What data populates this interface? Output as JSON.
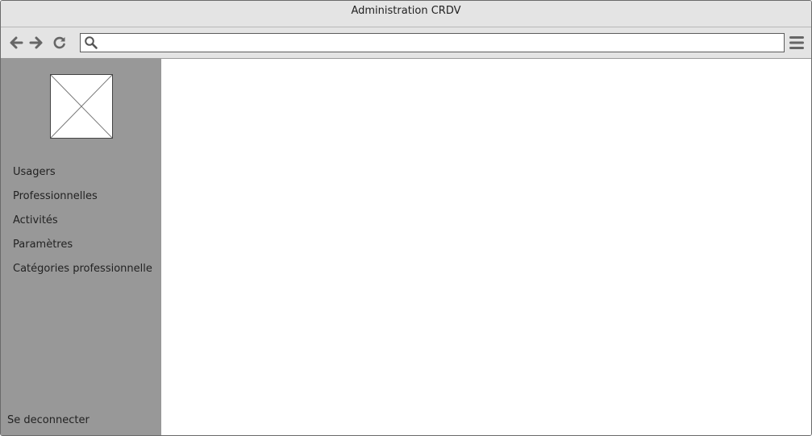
{
  "window": {
    "title": "Administration CRDV"
  },
  "toolbar": {
    "back_icon": "arrow-left-icon",
    "forward_icon": "arrow-right-icon",
    "reload_icon": "reload-icon",
    "search_icon": "search-icon",
    "menu_icon": "hamburger-menu-icon",
    "address_value": ""
  },
  "sidebar": {
    "logo": "image-placeholder",
    "items": [
      {
        "label": "Usagers"
      },
      {
        "label": "Professionnelles"
      },
      {
        "label": "Activités"
      },
      {
        "label": "Paramètres"
      },
      {
        "label": "Catégories professionnelle"
      }
    ],
    "logout_label": "Se deconnecter",
    "background": "#989898"
  }
}
